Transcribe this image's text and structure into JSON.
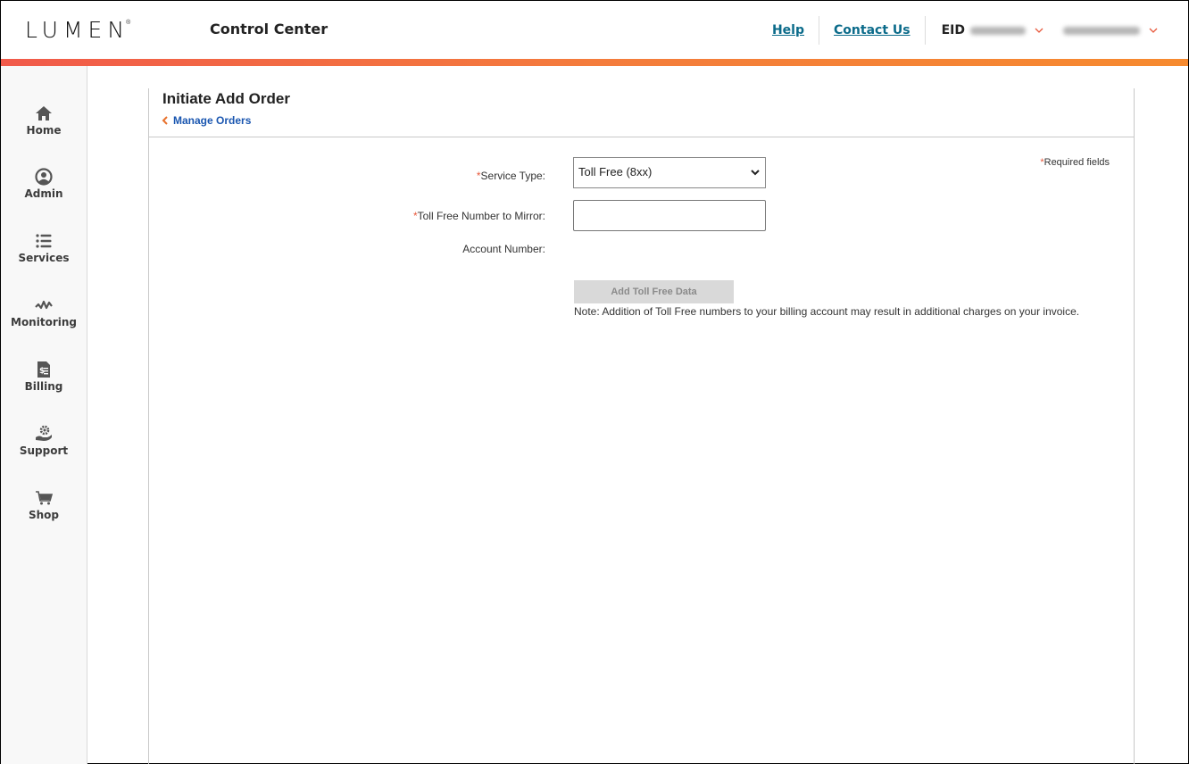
{
  "header": {
    "logo_text": "LUMEN",
    "logo_mark": "®",
    "app_title": "Control Center",
    "links": [
      {
        "label": "Help"
      },
      {
        "label": "Contact Us"
      }
    ],
    "eid_label": "EID",
    "eid_value_redacted": true,
    "user_redacted": true,
    "accent_colors": [
      "#f15a4a",
      "#f68a2f"
    ]
  },
  "sidebar": {
    "items": [
      {
        "label": "Home",
        "icon": "home-icon"
      },
      {
        "label": "Admin",
        "icon": "user-circle-icon"
      },
      {
        "label": "Services",
        "icon": "list-icon"
      },
      {
        "label": "Monitoring",
        "icon": "pulse-icon"
      },
      {
        "label": "Billing",
        "icon": "invoice-icon"
      },
      {
        "label": "Support",
        "icon": "support-gear-hand-icon"
      },
      {
        "label": "Shop",
        "icon": "cart-icon"
      }
    ]
  },
  "main": {
    "page_title": "Initiate Add Order",
    "back_link": "Manage Orders",
    "required_note": {
      "star": "*",
      "text": "Required fields"
    },
    "form": {
      "service_type": {
        "star": "*",
        "label": "Service Type:",
        "value": "Toll Free (8xx)"
      },
      "toll_free_number": {
        "star": "*",
        "label": "Toll Free Number to Mirror:",
        "value": "",
        "placeholder": ""
      },
      "account_number": {
        "label": "Account Number:",
        "value": ""
      }
    },
    "add_button": {
      "label": "Add Toll Free Data",
      "disabled": true
    },
    "note": "Note: Addition of Toll Free numbers to your billing account may result in additional charges on your invoice."
  }
}
